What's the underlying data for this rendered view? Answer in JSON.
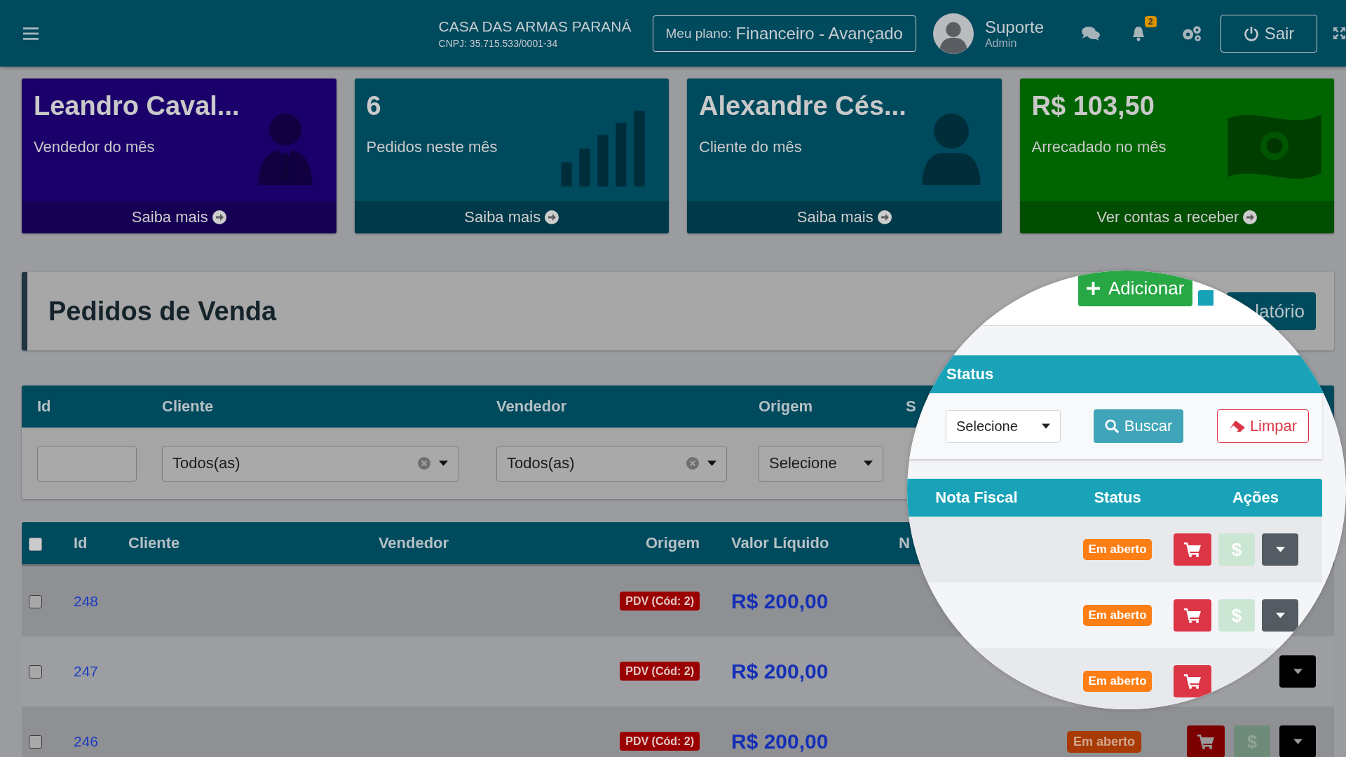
{
  "topbar": {
    "company": "CASA DAS ARMAS PARANÁ",
    "cnpj": "CNPJ: 35.715.533/0001-34",
    "plan_label": "Meu plano:",
    "plan_value": "Financeiro - Avançado",
    "user_name": "Suporte",
    "user_role": "Admin",
    "notification_count": "2",
    "logout": "Sair"
  },
  "cards": [
    {
      "value": "Leandro Caval...",
      "label": "Vendedor do mês",
      "link": "Saiba mais",
      "color": "#1b006b",
      "kind": "seller"
    },
    {
      "value": "6",
      "label": "Pedidos neste mês",
      "link": "Saiba mais",
      "color": "#004a5e",
      "kind": "orders"
    },
    {
      "value": "Alexandre Cés...",
      "label": "Cliente do mês",
      "link": "Saiba mais",
      "color": "#004a5e",
      "kind": "client"
    },
    {
      "value": "R$ 103,50",
      "label": "Arrecadado no mês",
      "link": "Ver contas a receber",
      "color": "#006400",
      "kind": "money"
    }
  ],
  "page_header": {
    "title": "Pedidos de Venda",
    "report_button": "latório"
  },
  "filters": {
    "columns": [
      "Id",
      "Cliente",
      "Vendedor",
      "Origem",
      "S"
    ],
    "fields": [
      {
        "kind": "input"
      },
      {
        "kind": "select",
        "value": "Todos(as)",
        "clearable": true
      },
      {
        "kind": "select",
        "value": "Todos(as)",
        "clearable": true
      },
      {
        "kind": "select",
        "value": "Selecione",
        "clearable": false
      }
    ]
  },
  "table": {
    "select_all": false,
    "columns": [
      "Id",
      "Cliente",
      "Vendedor",
      "Origem",
      "Valor Líquido",
      "N"
    ],
    "rows": [
      {
        "checked": false,
        "id": "248",
        "origin": "PDV (Cód: 2)",
        "value": "R$ 200,00"
      },
      {
        "checked": false,
        "id": "247",
        "origin": "PDV (Cód: 2)",
        "value": "R$ 200,00",
        "actions": [
          {
            "kind": "menu"
          }
        ]
      },
      {
        "checked": false,
        "id": "246",
        "origin": "PDV (Cód: 2)",
        "value": "R$ 200,00",
        "status": "Em aberto",
        "actions": [
          {
            "kind": "cart"
          },
          {
            "kind": "pay",
            "symbol": "$"
          },
          {
            "kind": "menu"
          }
        ]
      }
    ]
  },
  "magnifier": {
    "buttons": [
      {
        "kind": "add",
        "label": "Adicionar"
      },
      {
        "kind": "report"
      }
    ],
    "filter": {
      "column": "Status",
      "select": "Selecione",
      "search": "Buscar",
      "clear": "Limpar"
    },
    "table": {
      "columns": [
        "Nota Fiscal",
        "Status",
        "Ações"
      ],
      "rows": [
        {
          "status": "Em aberto",
          "actions": [
            {
              "kind": "cart"
            },
            {
              "kind": "pay",
              "symbol": "$"
            },
            {
              "kind": "menu"
            }
          ]
        },
        {
          "status": "Em aberto",
          "actions": [
            {
              "kind": "cart"
            },
            {
              "kind": "pay",
              "symbol": "$"
            },
            {
              "kind": "menu"
            }
          ]
        },
        {
          "status": "Em aberto",
          "actions": [
            {
              "kind": "cart"
            }
          ]
        }
      ]
    }
  }
}
